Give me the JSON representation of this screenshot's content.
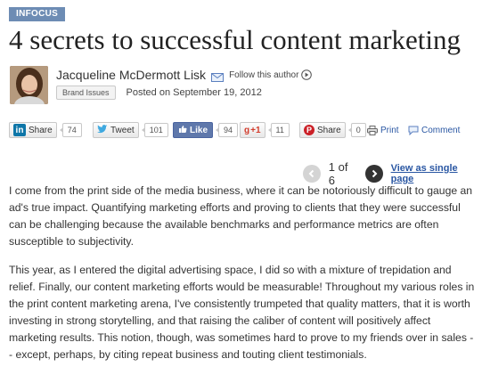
{
  "badge": "INFOCUS",
  "title": "4 secrets to successful content marketing",
  "author": {
    "name": "Jacqueline McDermott Lisk",
    "follow_label": "Follow this author",
    "tag": "Brand Issues",
    "posted": "Posted on September 19, 2012"
  },
  "share": {
    "linkedin": {
      "label": "Share",
      "count": "74"
    },
    "twitter": {
      "label": "Tweet",
      "count": "101"
    },
    "facebook": {
      "label": "Like",
      "count": "94"
    },
    "gplus": {
      "label": "+1",
      "count": "11"
    },
    "pinterest": {
      "label": "Share",
      "count": "0"
    },
    "print_label": "Print",
    "comment_label": "Comment"
  },
  "pager": {
    "current": "1 of 6",
    "single_page_label": "View as single page"
  },
  "paragraphs": [
    "I come from the print side of the media business, where it can be notoriously difficult to gauge an ad's true impact. Quantifying marketing efforts and proving to clients that they were successful can be challenging because the available benchmarks and performance metrics are often susceptible to subjectivity.",
    "This year, as I entered the digital advertising space, I did so with a mixture of trepidation and relief. Finally, our content marketing efforts would be measurable! Throughout my various roles in the print content marketing arena, I've consistently trumpeted that quality matters, that it is worth investing in strong storytelling, and that raising the caliber of content will positively affect marketing results. This notion, though, was sometimes hard to prove to my friends over in sales -- except, perhaps, by citing repeat business and touting client testimonials."
  ],
  "colors": {
    "badge_bg": "#6d8cb4",
    "link": "#2a57a3",
    "facebook": "#5f78ab",
    "linkedin": "#0e76a8",
    "gplus": "#d23b2b"
  }
}
